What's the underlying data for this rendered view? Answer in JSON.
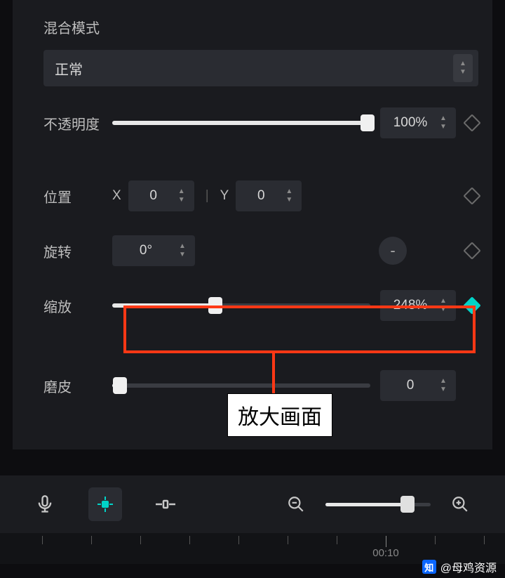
{
  "blend_mode": {
    "label": "混合模式",
    "value": "正常"
  },
  "opacity": {
    "label": "不透明度",
    "value": "100%",
    "percent": 100
  },
  "position": {
    "label": "位置",
    "x_label": "X",
    "x": "0",
    "y_label": "Y",
    "y": "0"
  },
  "rotation": {
    "label": "旋转",
    "value": "0°",
    "reset": "-"
  },
  "scale": {
    "label": "缩放",
    "value": "248%",
    "percent": 40
  },
  "smooth": {
    "label": "磨皮",
    "value": "0",
    "percent": 3
  },
  "callout": "放大画面",
  "timeline": {
    "tick_label": "00:10"
  },
  "watermark": {
    "logo": "知",
    "text": "@母鸡资源"
  }
}
